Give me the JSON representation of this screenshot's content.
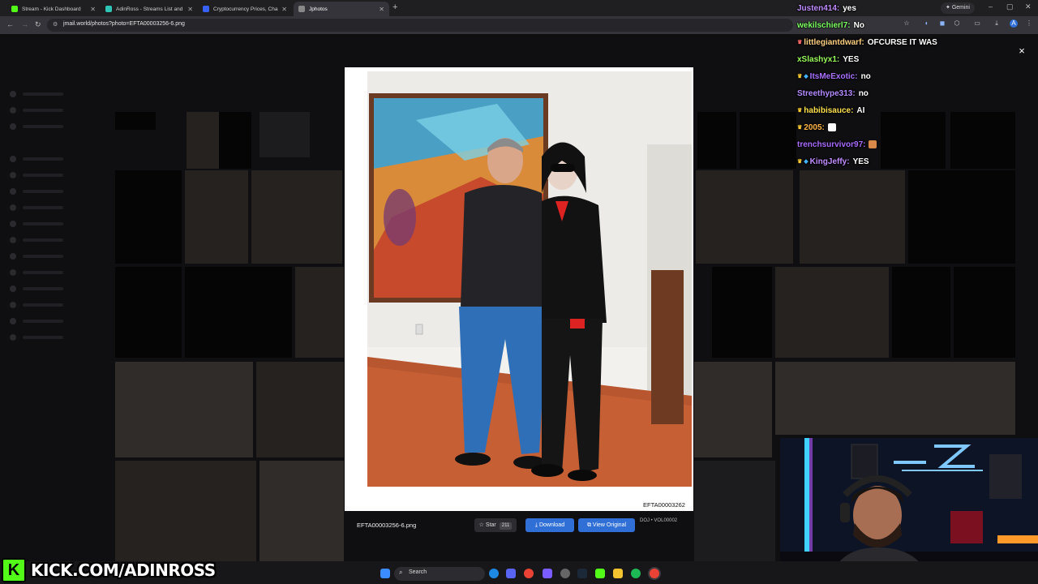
{
  "browser": {
    "tabs": [
      {
        "label": "Stream - Kick Dashboard",
        "favicon": "kick-icon",
        "color": "#53fc18"
      },
      {
        "label": "AdinRoss - Streams List and St",
        "favicon": "tracker-icon",
        "color": "#2ec4b6"
      },
      {
        "label": "Cryptocurrency Prices, Charts A",
        "favicon": "coin-icon",
        "color": "#3861fb"
      },
      {
        "label": "Jphotos",
        "favicon": "photo-icon",
        "color": "#888888"
      }
    ],
    "active_tab": 3,
    "new_tab": "+",
    "gemini_label": "Gemini",
    "url": "jmail.world/photos?photo=EFTA00003256-6.png"
  },
  "modal": {
    "file_name": "EFTA00003256-6.png",
    "photo_id_label": "EFTA00003262",
    "star_label": "Star",
    "star_count": "211",
    "download_label": "Download",
    "view_original_label": "View Original",
    "source_label": "DOJ • VOL00002",
    "close": "×"
  },
  "chat": {
    "messages": [
      {
        "user": "Justen414:",
        "text": "yes",
        "color": "#c08cff",
        "badge": ""
      },
      {
        "user": "wekilschierl7:",
        "text": "No",
        "color": "#7dff62",
        "badge": ""
      },
      {
        "user": "littlegiantdwarf:",
        "text": "OFCURSE IT WAS",
        "color": "#ffd080",
        "badge": "♛"
      },
      {
        "user": "xSlashyx1:",
        "text": "YES",
        "color": "#9aff5a",
        "badge": ""
      },
      {
        "user": "ItsMeExotic:",
        "text": "no",
        "color": "#a971ff",
        "badge": "♛"
      },
      {
        "user": "Streethype313:",
        "text": "no",
        "color": "#b38bff",
        "badge": ""
      },
      {
        "user": "habibisauce:",
        "text": "AI",
        "color": "#ffe14d",
        "badge": "♛"
      },
      {
        "user": "2005:",
        "text": "",
        "color": "#ffb347",
        "badge": "♛"
      },
      {
        "user": "trenchsurvivor97:",
        "text": "",
        "color": "#a86bff",
        "badge": ""
      },
      {
        "user": "KingJeffy:",
        "text": "YES",
        "color": "#c08cff",
        "badge": "♛"
      }
    ]
  },
  "taskbar": {
    "search_label": "Search"
  },
  "branding": {
    "kick_letter": "K",
    "kick_url": "KICK.COM/ADINROSS"
  }
}
